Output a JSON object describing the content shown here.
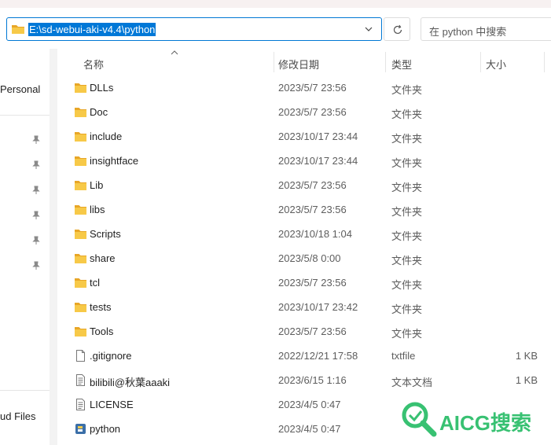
{
  "address": {
    "path": "E:\\sd-webui-aki-v4.4\\python"
  },
  "search": {
    "placeholder": "在 python 中搜索"
  },
  "nav": {
    "personal_label": "Personal",
    "cloud_label": "ud Files"
  },
  "columns": {
    "name": "名称",
    "date": "修改日期",
    "type": "类型",
    "size": "大小"
  },
  "files": [
    {
      "name": "DLLs",
      "date": "2023/5/7 23:56",
      "type": "文件夹",
      "size": "",
      "icon": "folder-icon"
    },
    {
      "name": "Doc",
      "date": "2023/5/7 23:56",
      "type": "文件夹",
      "size": "",
      "icon": "folder-icon"
    },
    {
      "name": "include",
      "date": "2023/10/17 23:44",
      "type": "文件夹",
      "size": "",
      "icon": "folder-icon"
    },
    {
      "name": "insightface",
      "date": "2023/10/17 23:44",
      "type": "文件夹",
      "size": "",
      "icon": "folder-icon"
    },
    {
      "name": "Lib",
      "date": "2023/5/7 23:56",
      "type": "文件夹",
      "size": "",
      "icon": "folder-icon"
    },
    {
      "name": "libs",
      "date": "2023/5/7 23:56",
      "type": "文件夹",
      "size": "",
      "icon": "folder-icon"
    },
    {
      "name": "Scripts",
      "date": "2023/10/18 1:04",
      "type": "文件夹",
      "size": "",
      "icon": "folder-icon"
    },
    {
      "name": "share",
      "date": "2023/5/8 0:00",
      "type": "文件夹",
      "size": "",
      "icon": "folder-icon"
    },
    {
      "name": "tcl",
      "date": "2023/5/7 23:56",
      "type": "文件夹",
      "size": "",
      "icon": "folder-icon"
    },
    {
      "name": "tests",
      "date": "2023/10/17 23:42",
      "type": "文件夹",
      "size": "",
      "icon": "folder-icon"
    },
    {
      "name": "Tools",
      "date": "2023/5/7 23:56",
      "type": "文件夹",
      "size": "",
      "icon": "folder-icon"
    },
    {
      "name": ".gitignore",
      "date": "2022/12/21 17:58",
      "type": "txtfile",
      "size": "1 KB",
      "icon": "file-icon"
    },
    {
      "name": "bilibili@秋葉aaaki",
      "date": "2023/6/15 1:16",
      "type": "文本文档",
      "size": "1 KB",
      "icon": "text-file-icon"
    },
    {
      "name": "LICENSE",
      "date": "2023/4/5 0:47",
      "type": "",
      "size": "",
      "icon": "text-file-icon"
    },
    {
      "name": "python",
      "date": "2023/4/5 0:47",
      "type": "",
      "size": "",
      "icon": "python-icon"
    }
  ],
  "watermark": {
    "text": "AICG搜索"
  },
  "colors": {
    "accent": "#0078d4",
    "selection": "#0078d7",
    "folder": "#f4c03f",
    "watermark": "#38c172"
  }
}
